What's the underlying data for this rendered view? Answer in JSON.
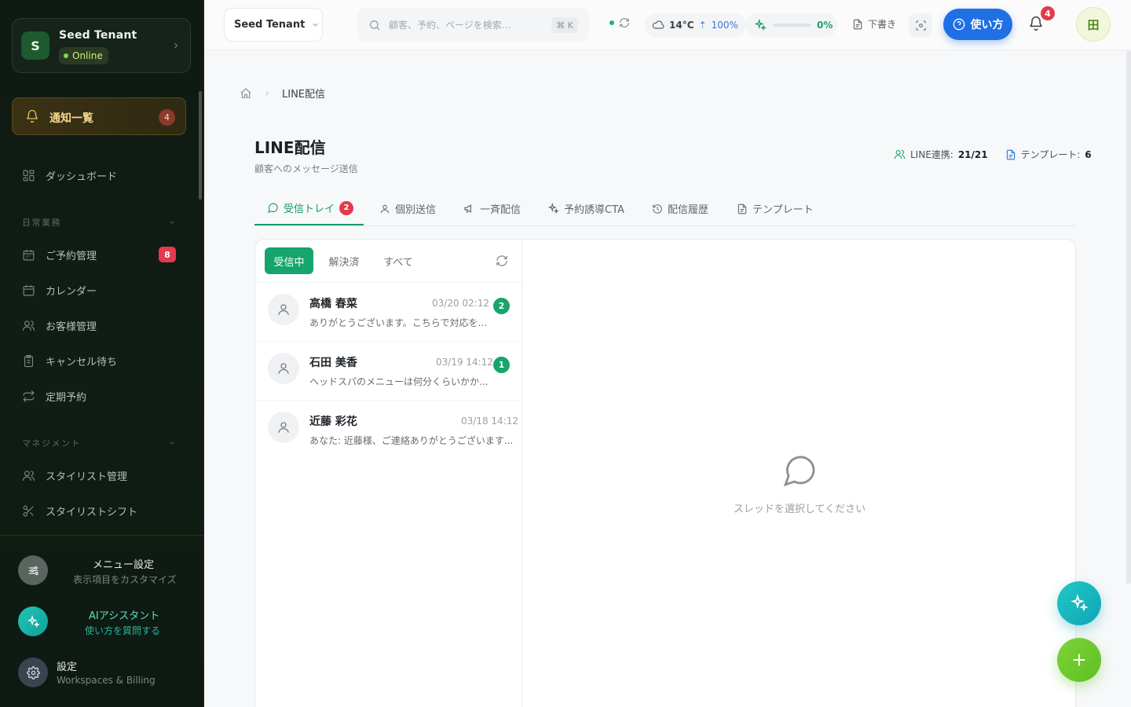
{
  "sidebar": {
    "tenant": {
      "initial": "S",
      "name": "Seed Tenant",
      "status": "Online"
    },
    "notifications": {
      "label": "通知一覧",
      "count": "4"
    },
    "dashboard": "ダッシュボード",
    "section_daily": "日常業務",
    "items_daily": [
      {
        "label": "ご予約管理",
        "badge": "8",
        "icon": "calendar-icon"
      },
      {
        "label": "カレンダー",
        "icon": "calendar-icon"
      },
      {
        "label": "お客様管理",
        "icon": "users-icon"
      },
      {
        "label": "キャンセル待ち",
        "icon": "clipboard-icon"
      },
      {
        "label": "定期予約",
        "icon": "repeat-icon"
      }
    ],
    "section_management": "マネジメント",
    "items_management": [
      {
        "label": "スタイリスト管理",
        "icon": "users-icon"
      },
      {
        "label": "スタイリストシフト",
        "icon": "scissors-icon"
      }
    ],
    "footer": {
      "menu_settings": {
        "title": "メニュー設定",
        "sub": "表示項目をカスタマイズ"
      },
      "ai_assistant": {
        "title": "AIアシスタント",
        "sub": "使い方を質問する"
      },
      "settings": {
        "title": "設定",
        "sub": "Workspaces & Billing"
      }
    }
  },
  "topbar": {
    "tenant_select": "Seed Tenant",
    "search": {
      "placeholder": "顧客、予約、ページを検索...",
      "shortcut": "⌘ K"
    },
    "weather": {
      "temp": "14°C",
      "humidity": "100%"
    },
    "ai_usage": {
      "percent": "0%",
      "fraction": 0
    },
    "drafts": "下書き",
    "help": "使い方",
    "notification_count": "4",
    "user_avatar": "田"
  },
  "breadcrumb": {
    "current": "LINE配信"
  },
  "page": {
    "title": "LINE配信",
    "subtitle": "顧客へのメッセージ送信",
    "stat_line_label": "LINE連携:",
    "stat_line_value": "21/21",
    "stat_template_label": "テンプレート:",
    "stat_template_value": "6"
  },
  "tabs": [
    {
      "label": "受信トレイ",
      "badge": "2",
      "active": true
    },
    {
      "label": "個別送信"
    },
    {
      "label": "一斉配信"
    },
    {
      "label": "予約誘導CTA"
    },
    {
      "label": "配信履歴"
    },
    {
      "label": "テンプレート"
    }
  ],
  "filters": {
    "open": "受信中",
    "resolved": "解決済",
    "all": "すべて"
  },
  "threads": [
    {
      "name": "高橋 春菜",
      "time": "03/20 02:12",
      "preview": "ありがとうございます。こちらで対応を...",
      "unread": "2"
    },
    {
      "name": "石田 美香",
      "time": "03/19 14:12",
      "preview": "ヘッドスパのメニューは何分くらいかか...",
      "unread": "1"
    },
    {
      "name": "近藤 彩花",
      "time": "03/18 14:12",
      "preview": "あなた: 近藤様、ご連絡ありがとうございます..."
    }
  ],
  "empty_state": "スレッドを選択してください",
  "colors": {
    "accent": "#16a56c",
    "primary": "#1f6fe5",
    "danger": "#e5394a"
  }
}
